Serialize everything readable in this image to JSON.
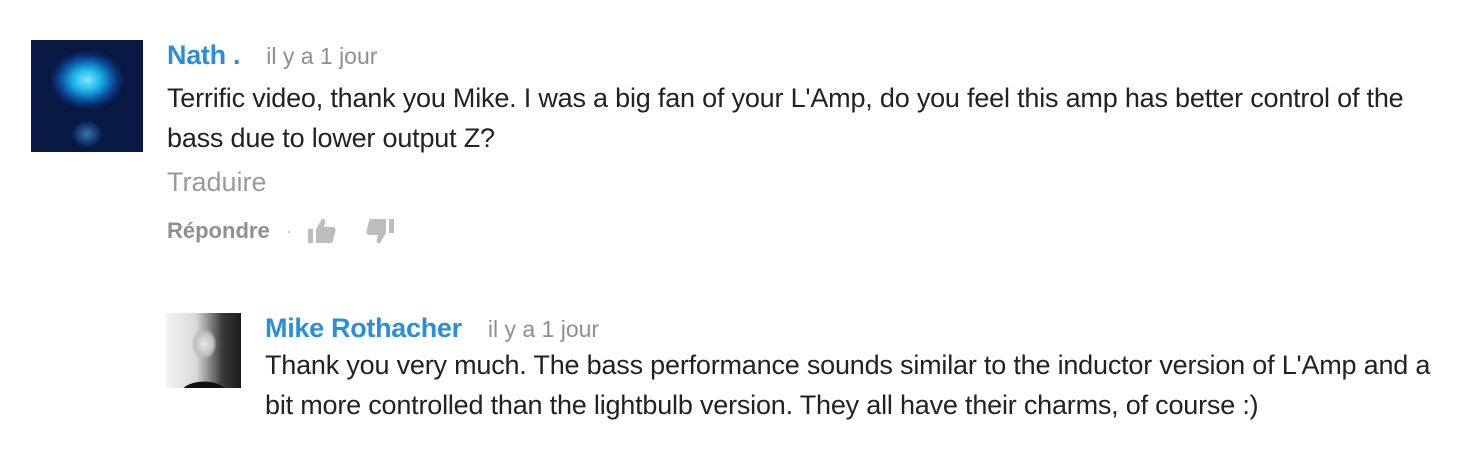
{
  "comment": {
    "author": "Nath .",
    "time": "il y a 1 jour",
    "text": "Terrific video, thank you Mike. I was a big fan of your L'Amp, do you feel this amp has better control of the bass due to lower output Z?",
    "translate_label": "Traduire",
    "reply_label": "Répondre",
    "separator": "·",
    "icons": [
      "thumbs-up-icon",
      "thumbs-down-icon"
    ]
  },
  "reply": {
    "author": "Mike Rothacher",
    "time": "il y a 1 jour",
    "text": "Thank you very much.  The bass performance sounds similar to the inductor version of L'Amp and a bit more controlled than the lightbulb version.  They all have their charms, of course :)"
  },
  "colors": {
    "author": "#2a8fd8",
    "muted": "#8f8f8f",
    "text": "#222222"
  }
}
